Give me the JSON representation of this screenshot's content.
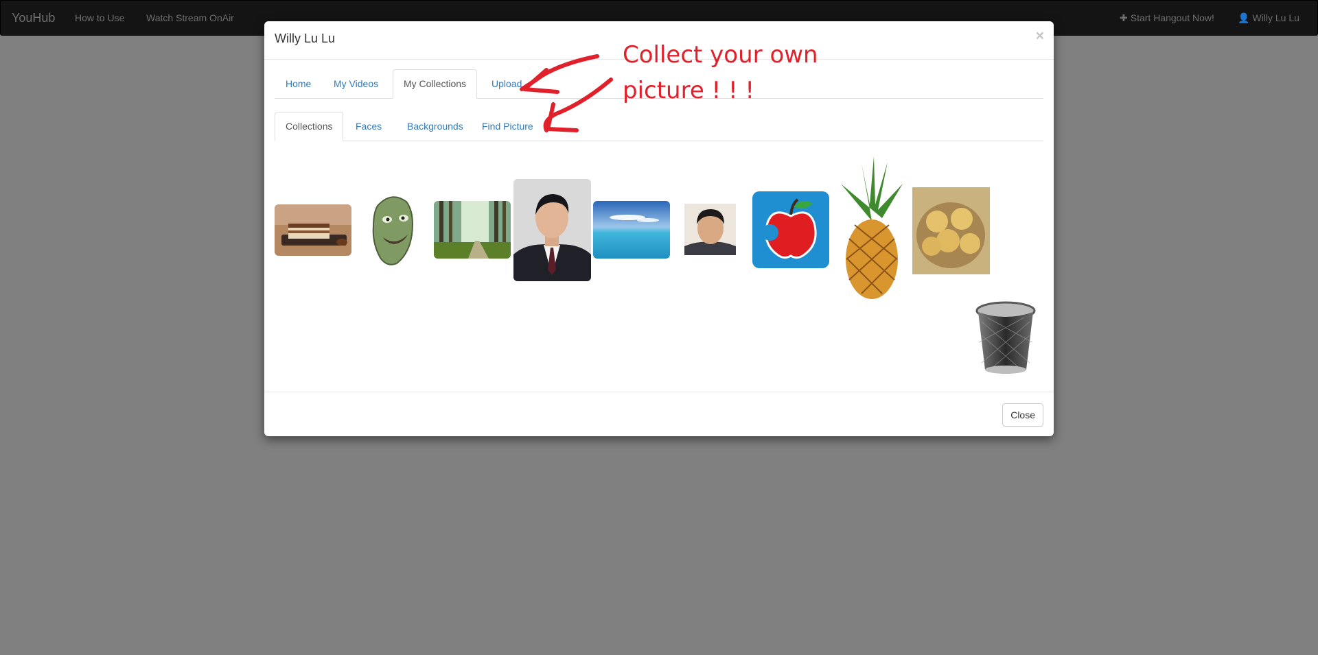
{
  "navbar": {
    "brand": "YouHub",
    "links": [
      "How to Use",
      "Watch Stream OnAir"
    ],
    "right": {
      "hangout": "Start Hangout Now!",
      "user": "Willy Lu Lu"
    }
  },
  "modal": {
    "title": "Willy Lu Lu",
    "close_x": "×",
    "main_tabs": [
      "Home",
      "My Videos",
      "My Collections",
      "Upload"
    ],
    "active_main_tab": "My Collections",
    "sub_tabs": [
      "Collections",
      "Faces",
      "Backgrounds",
      "Find Picture"
    ],
    "active_sub_tab": "Collections",
    "collection_items": [
      "tiramisu",
      "green-creature",
      "forest",
      "man-in-suit",
      "ocean-sky",
      "young-man-selfie",
      "apple-logo",
      "pineapple",
      "pears-basket"
    ],
    "trash_icon": "trash-bin-icon",
    "footer_close": "Close"
  },
  "annotation": {
    "line1": "Collect your own",
    "line2": "picture ! ! !",
    "color": "#e0202a"
  }
}
